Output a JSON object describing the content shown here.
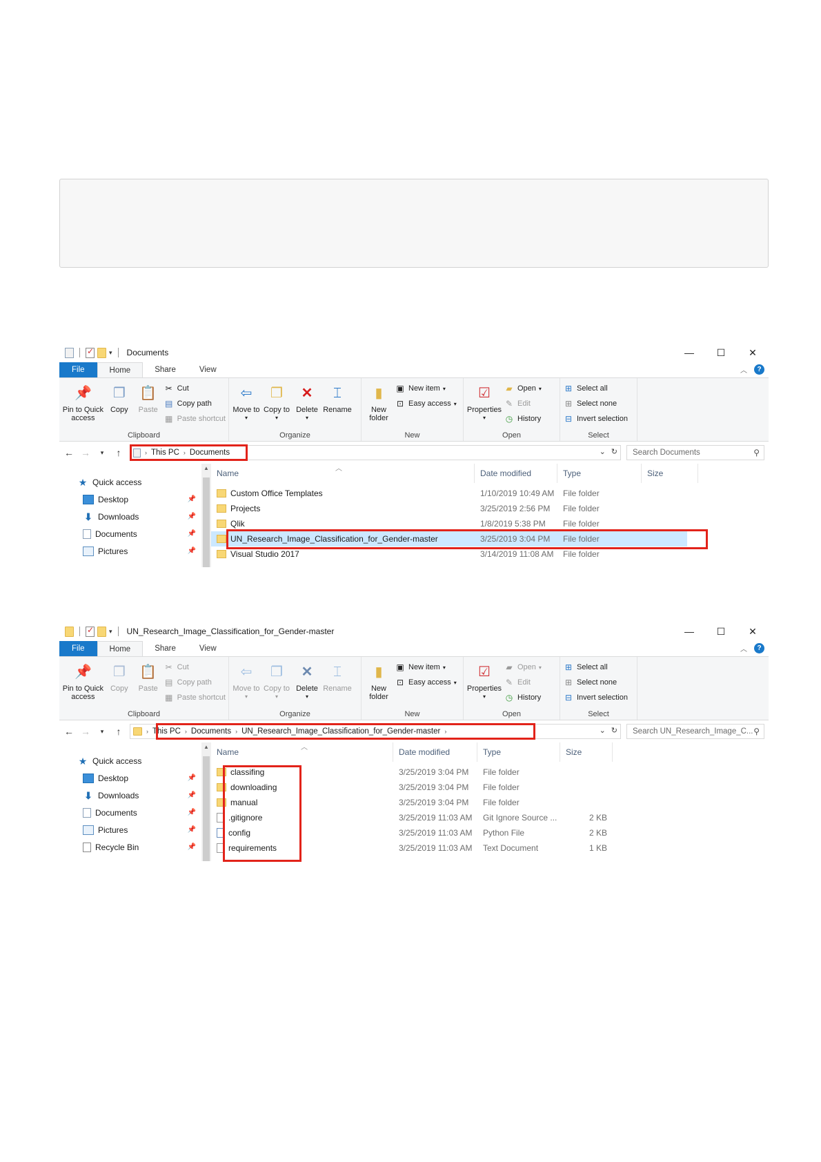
{
  "windows": [
    {
      "title": "Documents",
      "tabs": [
        "File",
        "Home",
        "Share",
        "View"
      ],
      "ribbon": {
        "clipboard": {
          "label": "Clipboard",
          "pin": "Pin to Quick access",
          "copy": "Copy",
          "paste": "Paste",
          "cut": "Cut",
          "copy_path": "Copy path",
          "paste_shortcut": "Paste shortcut"
        },
        "organize": {
          "label": "Organize",
          "move_to": "Move to",
          "copy_to": "Copy to",
          "delete": "Delete",
          "rename": "Rename"
        },
        "new": {
          "label": "New",
          "new_folder": "New folder",
          "new_item": "New item",
          "easy_access": "Easy access"
        },
        "open": {
          "label": "Open",
          "properties": "Properties",
          "open": "Open",
          "edit": "Edit",
          "history": "History"
        },
        "select": {
          "label": "Select",
          "select_all": "Select all",
          "select_none": "Select none",
          "invert": "Invert selection"
        }
      },
      "breadcrumb": [
        "This PC",
        "Documents"
      ],
      "search_placeholder": "Search Documents",
      "nav": [
        {
          "label": "Quick access",
          "icon": "star-icon"
        },
        {
          "label": "Desktop",
          "icon": "desktop-icon"
        },
        {
          "label": "Downloads",
          "icon": "download-icon"
        },
        {
          "label": "Documents",
          "icon": "document-icon"
        },
        {
          "label": "Pictures",
          "icon": "pictures-icon"
        }
      ],
      "columns": [
        "Name",
        "Date modified",
        "Type",
        "Size"
      ],
      "files": [
        {
          "name": "Custom Office Templates",
          "date": "1/10/2019 10:49 AM",
          "type": "File folder",
          "size": ""
        },
        {
          "name": "Projects",
          "date": "3/25/2019 2:56 PM",
          "type": "File folder",
          "size": ""
        },
        {
          "name": "Qlik",
          "date": "1/8/2019 5:38 PM",
          "type": "File folder",
          "size": ""
        },
        {
          "name": "UN_Research_Image_Classification_for_Gender-master",
          "date": "3/25/2019 3:04 PM",
          "type": "File folder",
          "size": ""
        },
        {
          "name": "Visual Studio 2017",
          "date": "3/14/2019 11:08 AM",
          "type": "File folder",
          "size": ""
        }
      ]
    },
    {
      "title": "UN_Research_Image_Classification_for_Gender-master",
      "tabs": [
        "File",
        "Home",
        "Share",
        "View"
      ],
      "ribbon": {
        "clipboard": {
          "label": "Clipboard",
          "pin": "Pin to Quick access",
          "copy": "Copy",
          "paste": "Paste",
          "cut": "Cut",
          "copy_path": "Copy path",
          "paste_shortcut": "Paste shortcut"
        },
        "organize": {
          "label": "Organize",
          "move_to": "Move to",
          "copy_to": "Copy to",
          "delete": "Delete",
          "rename": "Rename"
        },
        "new": {
          "label": "New",
          "new_folder": "New folder",
          "new_item": "New item",
          "easy_access": "Easy access"
        },
        "open": {
          "label": "Open",
          "properties": "Properties",
          "open": "Open",
          "edit": "Edit",
          "history": "History"
        },
        "select": {
          "label": "Select",
          "select_all": "Select all",
          "select_none": "Select none",
          "invert": "Invert selection"
        }
      },
      "breadcrumb": [
        "This PC",
        "Documents",
        "UN_Research_Image_Classification_for_Gender-master"
      ],
      "search_placeholder": "Search UN_Research_Image_C...",
      "nav": [
        {
          "label": "Quick access",
          "icon": "star-icon"
        },
        {
          "label": "Desktop",
          "icon": "desktop-icon"
        },
        {
          "label": "Downloads",
          "icon": "download-icon"
        },
        {
          "label": "Documents",
          "icon": "document-icon"
        },
        {
          "label": "Pictures",
          "icon": "pictures-icon"
        },
        {
          "label": "Recycle Bin",
          "icon": "recycle-bin-icon"
        }
      ],
      "columns": [
        "Name",
        "Date modified",
        "Type",
        "Size"
      ],
      "files": [
        {
          "name": "classifing",
          "date": "3/25/2019 3:04 PM",
          "type": "File folder",
          "size": "",
          "icon": "folder"
        },
        {
          "name": "downloading",
          "date": "3/25/2019 3:04 PM",
          "type": "File folder",
          "size": "",
          "icon": "folder"
        },
        {
          "name": "manual",
          "date": "3/25/2019 3:04 PM",
          "type": "File folder",
          "size": "",
          "icon": "folder"
        },
        {
          "name": ".gitignore",
          "date": "3/25/2019 11:03 AM",
          "type": "Git Ignore Source ...",
          "size": "2 KB",
          "icon": "file"
        },
        {
          "name": "config",
          "date": "3/25/2019 11:03 AM",
          "type": "Python File",
          "size": "2 KB",
          "icon": "py"
        },
        {
          "name": "requirements",
          "date": "3/25/2019 11:03 AM",
          "type": "Text Document",
          "size": "1 KB",
          "icon": "file"
        }
      ]
    }
  ],
  "colors": {
    "accent": "#1979ca",
    "highlight": "#e2231a",
    "selected_row": "#cce8ff"
  }
}
